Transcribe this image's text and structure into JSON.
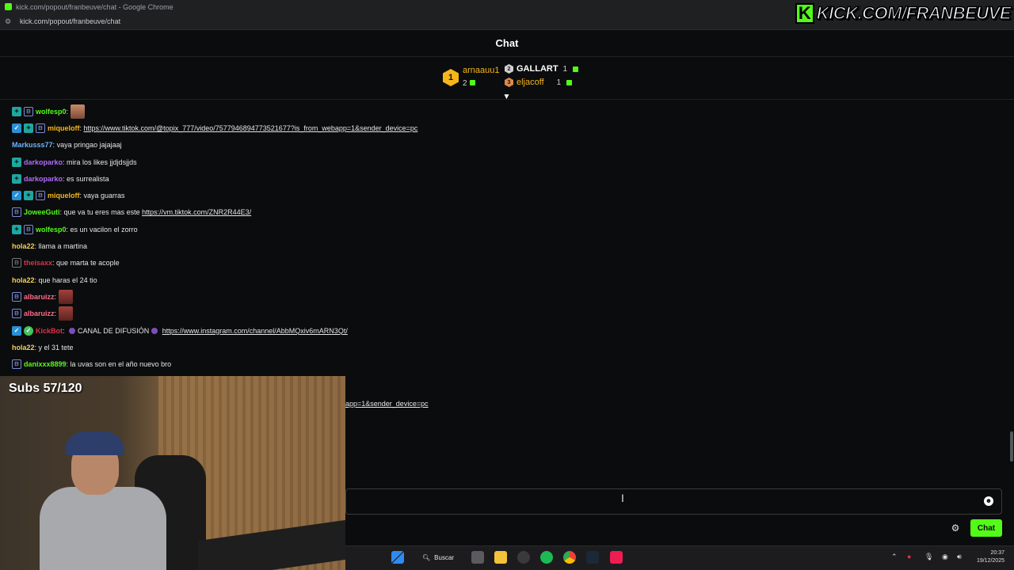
{
  "browser": {
    "window_title": "kick.com/popout/franbeuve/chat - Google Chrome",
    "url": "kick.com/popout/franbeuve/chat"
  },
  "overlay": {
    "logo_letter": "K",
    "logo_text": "KICK.COM/FRANBEUVE",
    "subs_text": "Subs 57/120"
  },
  "chat": {
    "title": "Chat",
    "send_label": "Chat",
    "input_placeholder": ""
  },
  "leaderboard": {
    "first": {
      "rank": "1",
      "name": "arnaauu1",
      "count": "2"
    },
    "second": {
      "rank": "2",
      "name": "GALLART",
      "count": "1"
    },
    "third": {
      "rank": "3",
      "name": "eljacoff",
      "count": "1"
    }
  },
  "colors": {
    "kick_green": "#53fc18",
    "gold": "#f5b619",
    "background": "#0b0c0d"
  },
  "messages": [
    {
      "user": "wolfesp0",
      "color": "#53fc18",
      "text": "",
      "emote": true
    },
    {
      "user": "miqueloff",
      "color": "#f5b619",
      "text": "",
      "link": "https://www.tiktok.com/@topix_777/video/7577946894773521677?is_from_webapp=1&sender_device=pc"
    },
    {
      "user": "Markusss77",
      "color": "#6eb4ff",
      "text": "vaya pringao jajajaaj"
    },
    {
      "user": "darkoparko",
      "color": "#b06bff",
      "text": "mira los likes jjdjdsjjds"
    },
    {
      "user": "darkoparko",
      "color": "#b06bff",
      "text": "es surrealista"
    },
    {
      "user": "miqueloff",
      "color": "#f5b619",
      "text": "vaya guarras"
    },
    {
      "user": "JoweeGuti",
      "color": "#53fc18",
      "text": "que va tu eres mas este ",
      "link": "https://vm.tiktok.com/ZNR2R44E3/"
    },
    {
      "user": "wolfesp0",
      "color": "#53fc18",
      "text": "es un vacilon el zorro"
    },
    {
      "user": "hola22",
      "color": "#f5d05a",
      "text": "llama a martina"
    },
    {
      "user": "theisaxx",
      "color": "#e0304a",
      "text": "que marta te acople"
    },
    {
      "user": "hola22",
      "color": "#f5d05a",
      "text": "que haras el 24 tio"
    },
    {
      "user": "albaruizz",
      "color": "#ff6a8a",
      "text": "",
      "emote": true
    },
    {
      "user": "albaruizz",
      "color": "#ff6a8a",
      "text": "",
      "emote": true
    },
    {
      "user": "KickBot",
      "color": "#e0304a",
      "text": "CANAL DE DIFUSIÓN",
      "link": "https://www.instagram.com/channel/AbbMQxiv6mARN3Qt/"
    },
    {
      "user": "hola22",
      "color": "#f5d05a",
      "text": "y el 31 tete"
    },
    {
      "user": "danixxx8899",
      "color": "#53fc18",
      "text": "la uvas son en el año nuevo bro"
    }
  ],
  "hidden_message_tail": "app=1&sender_device=pc",
  "taskbar": {
    "search_label": "Buscar",
    "time": "20:37",
    "date": "19/12/2025"
  }
}
